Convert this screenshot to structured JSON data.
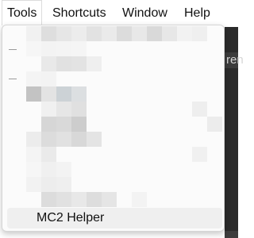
{
  "menubar": {
    "items": [
      {
        "label": "Tools",
        "active": true
      },
      {
        "label": "Shortcuts"
      },
      {
        "label": "Window"
      },
      {
        "label": "Help"
      }
    ]
  },
  "background": {
    "partial_text": "ren"
  },
  "dropdown": {
    "visible_item_label": "MC2 Helper",
    "pixelated_region": true
  },
  "colors": {
    "menu_bg": "#ffffff",
    "dropdown_bg": "#fbfbfb",
    "highlight_bg": "#efefef",
    "editor_dark": "#2b2b2b"
  }
}
